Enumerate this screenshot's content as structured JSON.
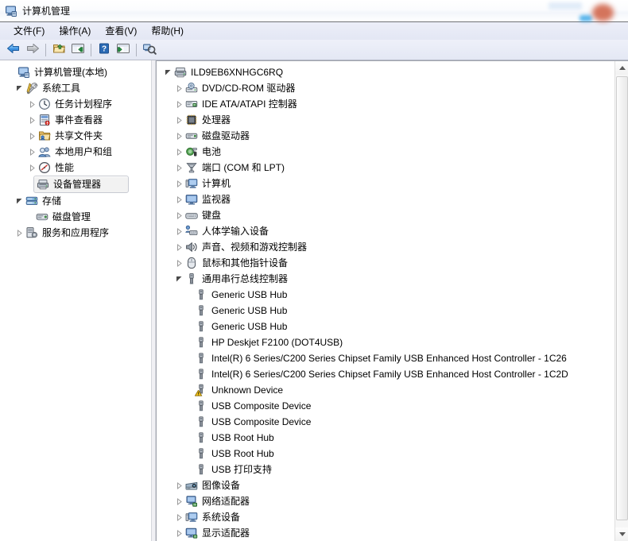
{
  "window": {
    "title": "计算机管理",
    "title_icon": "computer-management-icon"
  },
  "menu": {
    "items": [
      {
        "label": "文件(F)",
        "name": "menu-file"
      },
      {
        "label": "操作(A)",
        "name": "menu-action"
      },
      {
        "label": "查看(V)",
        "name": "menu-view"
      },
      {
        "label": "帮助(H)",
        "name": "menu-help"
      }
    ]
  },
  "toolbar": {
    "buttons": [
      {
        "name": "back-button",
        "icon": "back-arrow-icon"
      },
      {
        "name": "forward-button",
        "icon": "forward-arrow-icon"
      },
      {
        "name": "up-folder-button",
        "icon": "folder-up-icon"
      },
      {
        "name": "show-hide-tree-button",
        "icon": "show-tree-icon"
      },
      {
        "name": "help-button",
        "icon": "question-mark-icon"
      },
      {
        "name": "properties-button",
        "icon": "properties-window-icon"
      },
      {
        "name": "refresh-scan-button",
        "icon": "scan-hardware-icon"
      }
    ]
  },
  "sidebar": {
    "root": {
      "label": "计算机管理(本地)",
      "icon": "computer-icon"
    },
    "items": [
      {
        "label": "系统工具",
        "icon": "system-tools-icon",
        "level": 1,
        "state": "expanded",
        "selected": false
      },
      {
        "label": "任务计划程序",
        "icon": "clock-icon",
        "level": 2,
        "state": "collapsed",
        "selected": false
      },
      {
        "label": "事件查看器",
        "icon": "event-viewer-icon",
        "level": 2,
        "state": "collapsed",
        "selected": false
      },
      {
        "label": "共享文件夹",
        "icon": "shared-folder-icon",
        "level": 2,
        "state": "collapsed",
        "selected": false
      },
      {
        "label": "本地用户和组",
        "icon": "users-groups-icon",
        "level": 2,
        "state": "collapsed",
        "selected": false
      },
      {
        "label": "性能",
        "icon": "performance-icon",
        "level": 2,
        "state": "collapsed",
        "selected": false
      },
      {
        "label": "设备管理器",
        "icon": "device-manager-icon",
        "level": 2,
        "state": "leaf",
        "selected": true
      },
      {
        "label": "存储",
        "icon": "storage-icon",
        "level": 1,
        "state": "expanded",
        "selected": false
      },
      {
        "label": "磁盘管理",
        "icon": "disk-management-icon",
        "level": 2,
        "state": "leaf",
        "selected": false
      },
      {
        "label": "服务和应用程序",
        "icon": "services-apps-icon",
        "level": 1,
        "state": "collapsed",
        "selected": false
      }
    ]
  },
  "device_tree": {
    "root": {
      "label": "ILD9EB6XNHGC6RQ",
      "icon": "computer-root-icon",
      "state": "expanded"
    },
    "nodes": [
      {
        "label": "DVD/CD-ROM 驱动器",
        "icon": "dvd-drive-icon",
        "level": 1,
        "state": "collapsed"
      },
      {
        "label": "IDE ATA/ATAPI 控制器",
        "icon": "ide-controller-icon",
        "level": 1,
        "state": "collapsed"
      },
      {
        "label": "处理器",
        "icon": "processor-icon",
        "level": 1,
        "state": "collapsed"
      },
      {
        "label": "磁盘驱动器",
        "icon": "disk-drive-icon",
        "level": 1,
        "state": "collapsed"
      },
      {
        "label": "电池",
        "icon": "battery-icon",
        "level": 1,
        "state": "collapsed"
      },
      {
        "label": "端口 (COM 和 LPT)",
        "icon": "ports-icon",
        "level": 1,
        "state": "collapsed"
      },
      {
        "label": "计算机",
        "icon": "computer-node-icon",
        "level": 1,
        "state": "collapsed"
      },
      {
        "label": "监视器",
        "icon": "monitor-icon",
        "level": 1,
        "state": "collapsed"
      },
      {
        "label": "键盘",
        "icon": "keyboard-icon",
        "level": 1,
        "state": "collapsed"
      },
      {
        "label": "人体学输入设备",
        "icon": "hid-icon",
        "level": 1,
        "state": "collapsed"
      },
      {
        "label": "声音、视频和游戏控制器",
        "icon": "sound-video-icon",
        "level": 1,
        "state": "collapsed"
      },
      {
        "label": "鼠标和其他指针设备",
        "icon": "mouse-icon",
        "level": 1,
        "state": "collapsed"
      },
      {
        "label": "通用串行总线控制器",
        "icon": "usb-controller-icon",
        "level": 1,
        "state": "expanded"
      },
      {
        "label": "Generic USB Hub",
        "icon": "usb-device-icon",
        "level": 2,
        "state": "leaf"
      },
      {
        "label": "Generic USB Hub",
        "icon": "usb-device-icon",
        "level": 2,
        "state": "leaf"
      },
      {
        "label": "Generic USB Hub",
        "icon": "usb-device-icon",
        "level": 2,
        "state": "leaf"
      },
      {
        "label": "HP Deskjet F2100 (DOT4USB)",
        "icon": "usb-device-icon",
        "level": 2,
        "state": "leaf"
      },
      {
        "label": "Intel(R) 6 Series/C200 Series Chipset Family USB Enhanced Host Controller - 1C26",
        "icon": "usb-device-icon",
        "level": 2,
        "state": "leaf"
      },
      {
        "label": "Intel(R) 6 Series/C200 Series Chipset Family USB Enhanced Host Controller - 1C2D",
        "icon": "usb-device-icon",
        "level": 2,
        "state": "leaf"
      },
      {
        "label": "Unknown Device",
        "icon": "usb-device-warning-icon",
        "level": 2,
        "state": "leaf",
        "warning": true
      },
      {
        "label": "USB Composite Device",
        "icon": "usb-device-icon",
        "level": 2,
        "state": "leaf"
      },
      {
        "label": "USB Composite Device",
        "icon": "usb-device-icon",
        "level": 2,
        "state": "leaf"
      },
      {
        "label": "USB Root Hub",
        "icon": "usb-device-icon",
        "level": 2,
        "state": "leaf"
      },
      {
        "label": "USB Root Hub",
        "icon": "usb-device-icon",
        "level": 2,
        "state": "leaf"
      },
      {
        "label": "USB 打印支持",
        "icon": "usb-device-icon",
        "level": 2,
        "state": "leaf"
      },
      {
        "label": "图像设备",
        "icon": "imaging-device-icon",
        "level": 1,
        "state": "collapsed"
      },
      {
        "label": "网络适配器",
        "icon": "network-adapter-icon",
        "level": 1,
        "state": "collapsed"
      },
      {
        "label": "系统设备",
        "icon": "system-device-icon",
        "level": 1,
        "state": "collapsed"
      },
      {
        "label": "显示适配器",
        "icon": "display-adapter-icon",
        "level": 1,
        "state": "collapsed"
      }
    ]
  },
  "scrollbar": {
    "name": "right-pane-vertical-scrollbar",
    "up_arrow": "scroll-up-arrow-icon",
    "down_arrow": "scroll-down-arrow-icon"
  },
  "colors": {
    "titlebar_bg": "#ffffff",
    "menubar_bg": "#e6eaf5",
    "toolbar_bg": "#e9ecf6",
    "pane_bg": "#ffffff",
    "selected_bg": "#f2f2f2",
    "warning_yellow": "#f5c518",
    "accent_blue": "#2b6cb0"
  }
}
